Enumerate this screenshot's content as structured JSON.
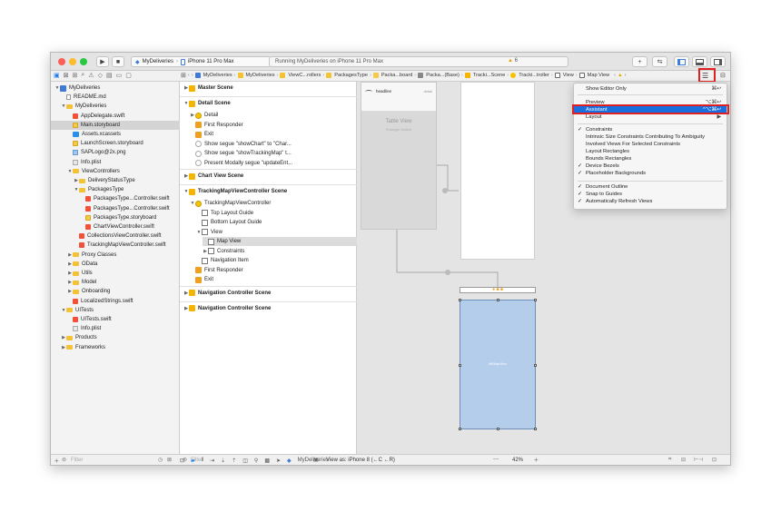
{
  "toolbar": {
    "scheme_app": "MyDeliveries",
    "scheme_device": "iPhone 11 Pro Max",
    "status_text": "Running MyDeliveries on iPhone 11 Pro Max",
    "warning_count": "6"
  },
  "jumpbar": {
    "items": [
      "MyDeliveries",
      "MyDeliveries",
      "ViewC...rollers",
      "PackagesType",
      "Packa...board",
      "Packa...(Base)",
      "Tracki...Scene",
      "Tracki...troller",
      "View",
      "Map View"
    ]
  },
  "navigator": {
    "items": [
      {
        "label": "MyDeliveries",
        "icon": "project",
        "indent": 0,
        "open": true
      },
      {
        "label": "README.md",
        "icon": "file",
        "indent": 1
      },
      {
        "label": "MyDeliveries",
        "icon": "folder",
        "indent": 1,
        "open": true
      },
      {
        "label": "AppDelegate.swift",
        "icon": "swift",
        "indent": 2
      },
      {
        "label": "Main.storyboard",
        "icon": "storyboard",
        "indent": 2,
        "selected": true
      },
      {
        "label": "Assets.xcassets",
        "icon": "assets",
        "indent": 2
      },
      {
        "label": "LaunchScreen.storyboard",
        "icon": "storyboard",
        "indent": 2
      },
      {
        "label": "SAPLogo@2x.png",
        "icon": "image",
        "indent": 2
      },
      {
        "label": "Info.plist",
        "icon": "plist",
        "indent": 2
      },
      {
        "label": "ViewControllers",
        "icon": "folder",
        "indent": 2,
        "open": true
      },
      {
        "label": "DeliveryStatusType",
        "icon": "folder",
        "indent": 3,
        "closed": true
      },
      {
        "label": "PackagesType",
        "icon": "folder",
        "indent": 3,
        "open": true
      },
      {
        "label": "PackagesType...Controller.swift",
        "icon": "swift",
        "indent": 4
      },
      {
        "label": "PackagesType...Controller.swift",
        "icon": "swift",
        "indent": 4
      },
      {
        "label": "PackagesType.storyboard",
        "icon": "storyboard",
        "indent": 4
      },
      {
        "label": "ChartViewController.swift",
        "icon": "swift",
        "indent": 4
      },
      {
        "label": "CollectionsViewController.swift",
        "icon": "swift",
        "indent": 3
      },
      {
        "label": "TrackingMapViewController.swift",
        "icon": "swift",
        "indent": 3
      },
      {
        "label": "Proxy Classes",
        "icon": "folder",
        "indent": 2,
        "closed": true
      },
      {
        "label": "OData",
        "icon": "folder",
        "indent": 2,
        "closed": true
      },
      {
        "label": "Utils",
        "icon": "folder",
        "indent": 2,
        "closed": true
      },
      {
        "label": "Model",
        "icon": "folder",
        "indent": 2,
        "closed": true
      },
      {
        "label": "Onboarding",
        "icon": "folder",
        "indent": 2,
        "closed": true
      },
      {
        "label": "LocalizedStrings.swift",
        "icon": "swift",
        "indent": 2
      },
      {
        "label": "UITests",
        "icon": "folder",
        "indent": 1,
        "open": true
      },
      {
        "label": "UITests.swift",
        "icon": "swift",
        "indent": 2
      },
      {
        "label": "Info.plist",
        "icon": "plist",
        "indent": 2
      },
      {
        "label": "Products",
        "icon": "folder",
        "indent": 1,
        "closed": true
      },
      {
        "label": "Frameworks",
        "icon": "folder",
        "indent": 1,
        "closed": true
      }
    ],
    "filter_placeholder": "Filter"
  },
  "outline": {
    "items": [
      {
        "label": "Master Scene",
        "icon": "scene",
        "indent": 0,
        "scene": true,
        "closed": true
      },
      {
        "label": "Detail Scene",
        "icon": "scene",
        "indent": 0,
        "scene": true,
        "open": true
      },
      {
        "label": "Detail",
        "icon": "vc",
        "indent": 1,
        "closed": true
      },
      {
        "label": "First Responder",
        "icon": "responder",
        "indent": 1
      },
      {
        "label": "Exit",
        "icon": "responder",
        "indent": 1
      },
      {
        "label": "Show segue \"showChart\" to \"Char...",
        "icon": "segue",
        "indent": 1
      },
      {
        "label": "Show segue \"showTrackingMap\" t...",
        "icon": "segue",
        "indent": 1
      },
      {
        "label": "Present Modally segue \"updateEnt...",
        "icon": "segue",
        "indent": 1
      },
      {
        "label": "Chart View Scene",
        "icon": "scene",
        "indent": 0,
        "scene": true,
        "closed": true
      },
      {
        "label": "TrackingMapViewController Scene",
        "icon": "scene",
        "indent": 0,
        "scene": true,
        "open": true
      },
      {
        "label": "TrackingMapViewController",
        "icon": "vc",
        "indent": 1,
        "open": true
      },
      {
        "label": "Top Layout Guide",
        "icon": "view",
        "indent": 2
      },
      {
        "label": "Bottom Layout Guide",
        "icon": "view",
        "indent": 2
      },
      {
        "label": "View",
        "icon": "view",
        "indent": 2,
        "open": true
      },
      {
        "label": "Map View",
        "icon": "view",
        "indent": 3,
        "selected": true
      },
      {
        "label": "Constraints",
        "icon": "view",
        "indent": 3,
        "closed": true
      },
      {
        "label": "Navigation Item",
        "icon": "view",
        "indent": 2
      },
      {
        "label": "First Responder",
        "icon": "responder",
        "indent": 1
      },
      {
        "label": "Exit",
        "icon": "responder",
        "indent": 1
      },
      {
        "label": "Navigation Controller Scene",
        "icon": "scene",
        "indent": 0,
        "scene": true,
        "closed": true
      },
      {
        "label": "Navigation Controller Scene",
        "icon": "scene",
        "indent": 0,
        "scene": true,
        "closed": true
      }
    ],
    "filter_placeholder": "Filter"
  },
  "canvas": {
    "table_view_title": "Table View",
    "table_view_subtitle": "Prototype Content",
    "cell_title": "headline",
    "cell_detail": "detail",
    "map_label": "MKMapView"
  },
  "bottom": {
    "view_as": "View as: iPhone 8 (←C ←R)",
    "zoom": "42%",
    "minus": "—",
    "plus": "+",
    "target": "MyDeliveries"
  },
  "menu": {
    "show_editor_only": "Show Editor Only",
    "show_editor_only_sc": "⌘↩",
    "preview": "Preview",
    "preview_sc": "⌥⌘↩",
    "assistant": "Assistant",
    "assistant_sc": "^⌥⌘↩",
    "layout": "Layout",
    "layout_sc": "▶",
    "checked": [
      {
        "label": "Constraints",
        "checked": true
      },
      {
        "label": "Intrinsic Size Constraints Contributing To Ambiguity",
        "checked": false
      },
      {
        "label": "Involved Views For Selected Constraints",
        "checked": false
      },
      {
        "label": "Layout Rectangles",
        "checked": false
      },
      {
        "label": "Bounds Rectangles",
        "checked": false
      },
      {
        "label": "Device Bezels",
        "checked": true
      },
      {
        "label": "Placeholder Backgrounds",
        "checked": true
      }
    ],
    "checked2": [
      {
        "label": "Document Outline",
        "checked": true
      },
      {
        "label": "Snap to Guides",
        "checked": true
      },
      {
        "label": "Automatically Refresh Views",
        "checked": true
      }
    ]
  },
  "colors": {
    "accent": "#1a6fe0",
    "highlight_red": "#e02020",
    "map_fill": "#b3cdea"
  }
}
